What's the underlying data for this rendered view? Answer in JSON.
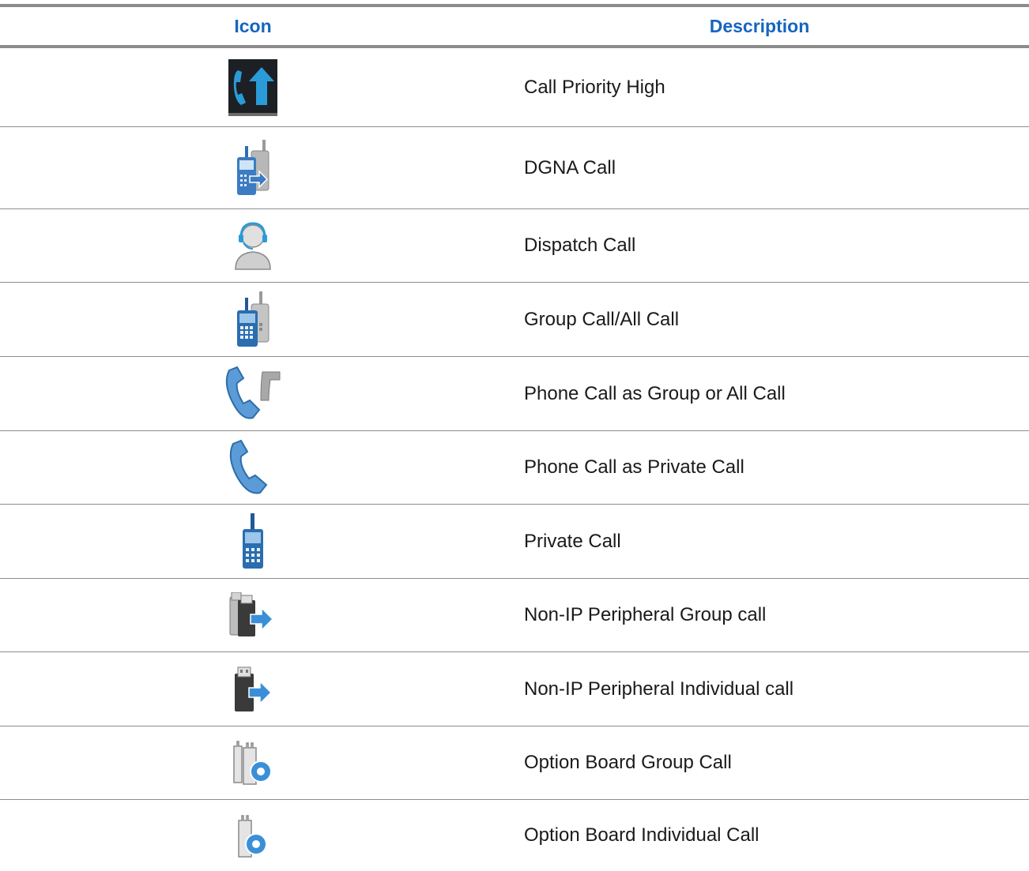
{
  "table": {
    "headers": {
      "icon": "Icon",
      "description": "Description"
    },
    "rows": [
      {
        "icon": "call-priority-high-icon",
        "description": "Call Priority High"
      },
      {
        "icon": "dgna-call-icon",
        "description": "DGNA Call"
      },
      {
        "icon": "dispatch-call-icon",
        "description": "Dispatch Call"
      },
      {
        "icon": "group-call-icon",
        "description": "Group Call/All Call"
      },
      {
        "icon": "phone-call-group-icon",
        "description": "Phone Call as Group or All Call"
      },
      {
        "icon": "phone-call-private-icon",
        "description": "Phone Call as Private Call"
      },
      {
        "icon": "private-call-icon",
        "description": "Private Call"
      },
      {
        "icon": "non-ip-peripheral-group-icon",
        "description": "Non-IP Peripheral Group call"
      },
      {
        "icon": "non-ip-peripheral-individual-icon",
        "description": "Non-IP Peripheral Individual call"
      },
      {
        "icon": "option-board-group-icon",
        "description": "Option Board Group Call"
      },
      {
        "icon": "option-board-individual-icon",
        "description": "Option Board Individual Call"
      }
    ]
  },
  "colors": {
    "header_text": "#1565c0",
    "rule": "#8c8c8c",
    "icon_blue": "#4a90d9",
    "icon_dark_blue": "#1f5a96"
  }
}
